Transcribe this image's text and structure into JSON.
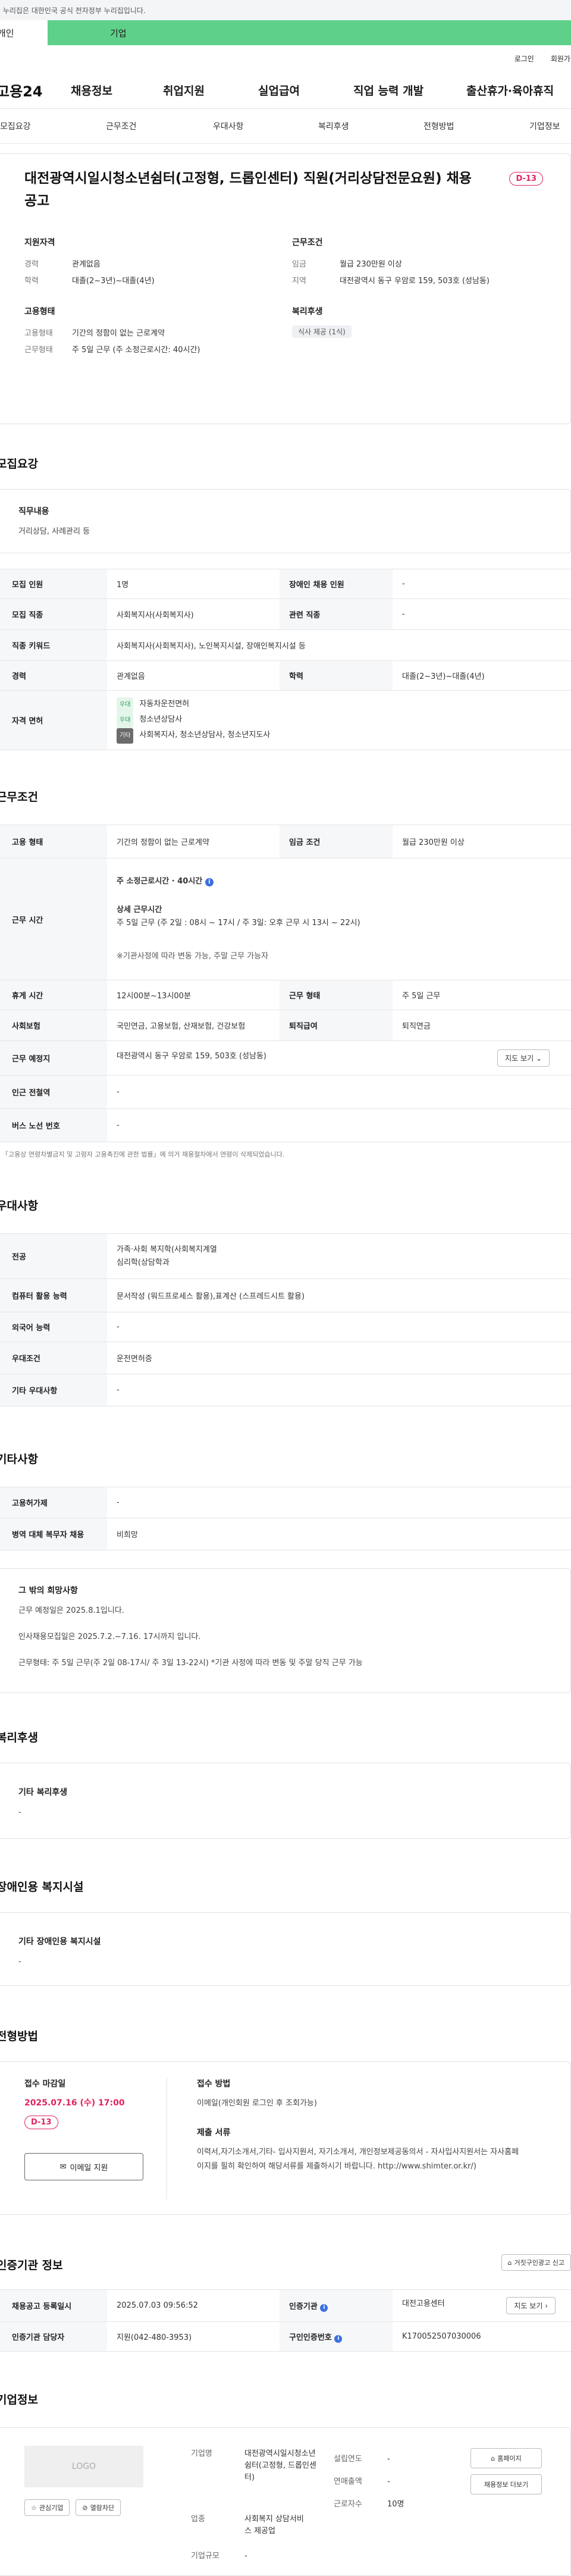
{
  "gov_banner": "이 누리집은 대한민국 공식 전자정부 누리집입니다.",
  "user_tabs": {
    "personal": "개인",
    "company": "기업"
  },
  "util": {
    "login": "로그인",
    "join": "회원가입"
  },
  "gnb": {
    "logo": "고용24",
    "menu": [
      "채용정보",
      "취업지원",
      "실업급여",
      "직업 능력 개발",
      "출산휴가·육아휴직"
    ]
  },
  "sub_tabs": [
    "모집요강",
    "근무조건",
    "우대사항",
    "복리후생",
    "전형방법",
    "기업정보"
  ],
  "summary": {
    "title": "대전광역시일시청소년쉼터(고정형, 드롭인센터) 직원(거리상담전문요원) 채용 공고",
    "dday": "D-13",
    "qual": {
      "heading": "지원자격",
      "career_k": "경력",
      "career_v": "관계없음",
      "edu_k": "학력",
      "edu_v": "대졸(2~3년)~대졸(4년)"
    },
    "cond": {
      "heading": "근무조건",
      "wage_k": "임금",
      "wage_v": "월급 230만원 이상",
      "loc_k": "지역",
      "loc_v": "대전광역시 동구 우암로 159, 503호 (성남동)"
    },
    "emp": {
      "heading": "고용형태",
      "type_k": "고용형태",
      "type_v": "기간의 정함이 없는 근로계약",
      "hours_k": "근무형태",
      "hours_v": "주 5일 근무 (주 소정근로시간: 40시간)"
    },
    "welfare": {
      "heading": "복리후생",
      "chip": "식사 제공 (1식)"
    }
  },
  "recruit": {
    "title": "모집요강",
    "duty_heading": "직무내용",
    "duty_text": "거리상담, 사례관리 등",
    "rows": {
      "count_k": "모집 인원",
      "count_v": "1명",
      "disabled_k": "장애인 채용 인원",
      "disabled_v": "-",
      "job_k": "모집 직종",
      "job_v": "사회복지사(사회복지사)",
      "industry_k": "관련 직종",
      "industry_v": "-",
      "keyword_k": "직종 키워드",
      "keyword_v": "사회복지사(사회복지사), 노인복지시설, 장애인복지시설 등",
      "career_k": "경력",
      "career_v": "관계없음",
      "edu_k": "학력",
      "edu_v": "대졸(2~3년)~대졸(4년)",
      "license_k": "자격 면허",
      "licenses": [
        {
          "tag": "우대",
          "name": "자동차운전면허"
        },
        {
          "tag": "우대",
          "name": "청소년상담사"
        },
        {
          "tag": "기타",
          "name": "사회복지사, 청소년상담사, 청소년지도사"
        }
      ]
    }
  },
  "work": {
    "title": "근무조건",
    "type_k": "고용 형태",
    "type_v": "기간의 정함이 없는 근로계약",
    "wage_k": "임금 조건",
    "wage_v": "월급 230만원 이상",
    "time_k": "근무 시간",
    "time_line1": "주 소정근로시간 · 40시간",
    "time_detail_h": "상세 근무시간",
    "time_detail": "주 5일 근무 (주 2일 : 08시 ~ 17시 / 주 3일: 오후 근무 시 13시 ~ 22시)",
    "time_note": "※기관사정에 따라 변동 가능, 주말 근무 가능자",
    "break_k": "휴게 시간",
    "break_v": "12시00분~13시00분",
    "form_k": "근무 형태",
    "form_v": "주 5일 근무",
    "ins_k": "사회보험",
    "ins_v": "국민연금, 고용보험, 산재보험, 건강보험",
    "retire_k": "퇴직급여",
    "retire_v": "퇴직연금",
    "place_k": "근무 예정지",
    "place_v": "대전광역시 동구 우암로 159, 503호 (성남동)",
    "map_btn": "지도 보기",
    "subway_k": "인근 전철역",
    "subway_v": "-",
    "bus_k": "버스 노선 번호",
    "bus_v": "-",
    "footnote": "* 「고용상 연령차별금지 및 고령자 고용촉진에 관한 법률」에 의거 채용절차에서 연령이 삭제되었습니다."
  },
  "pref": {
    "title": "우대사항",
    "major_k": "전공",
    "major_v1": "가족·사회 복지학(사회복지계열",
    "major_v2": "심리학(상담학과",
    "pc_k": "컴퓨터 활용 능력",
    "pc_v": "문서작성 (워드프로세스 활용),표계산 (스프레드시트 활용)",
    "lang_k": "외국어 능력",
    "lang_v": "-",
    "cond_k": "우대조건",
    "cond_v": "운전면허증",
    "etc_k": "기타 우대사항",
    "etc_v": "-"
  },
  "other": {
    "title": "기타사항",
    "dorm_k": "고용허가제",
    "dorm_v": "-",
    "mil_k": "병역 대체 복무자 채용",
    "mil_v": "비희망",
    "wish_h": "그 밖의 희망사항",
    "wish1": "근무 예정일은 2025.8.1입니다.",
    "wish2": "인사채용모집일은 2025.7.2.~7.16.  17시까지 입니다.",
    "wish3": "근무형태: 주 5일 근무(주 2일 08-17시/ 주 3일 13-22시) *기관 사정에 따라 변동 및 주말 당직 근무 가능"
  },
  "welfare": {
    "title": "복리후생",
    "h": "기타 복리후생",
    "v": "-"
  },
  "facility": {
    "title": "장애인용 복지시설",
    "h": "기타 장애인용 복지시설",
    "v": "-"
  },
  "method": {
    "title": "전형방법",
    "deadline_h": "접수 마감일",
    "deadline_v": "2025.07.16 (수) 17:00",
    "dday": "D-13",
    "apply_btn": "이메일 지원",
    "way_h": "접수 방법",
    "way_v": "이메일(개인회원 로그인 후 조회가능)",
    "docs_h": "제출 서류",
    "docs_v": "이력서,자기소개서,기타- 입사지원서, 자기소개서, 개인정보제공동의서 - 자사입사지원서는 자사홈페이지를 필히 확인하여 해당서류를 제출하시기 바랍니다.    http://www.shimter.or.kr/)"
  },
  "agency": {
    "title": "인증기관 정보",
    "report_btn": "거짓구인광고 신고",
    "date_k": "채용공고 등록일시",
    "date_v": "2025.07.03 09:56:52",
    "org_k": "인증기관",
    "org_v": "대전고용센터",
    "map_btn": "지도 보기",
    "mgr_k": "인증기관 담당자",
    "mgr_v": "지원(042-480-3953)",
    "no_k": "구인인증번호",
    "no_v": "K170052507030006"
  },
  "company": {
    "title": "기업정보",
    "logo": "LOGO",
    "fav_btn": "관심기업",
    "block_btn": "열람차단",
    "name_k": "기업명",
    "name_v": "대전광역시일시청소년쉼터(고정형, 드롭인센터)",
    "biz_k": "업종",
    "biz_v": "사회복지 상담서비스 제공업",
    "size_k": "기업규모",
    "size_v": "-",
    "founded_k": "설립연도",
    "founded_v": "-",
    "sales_k": "연매출액",
    "sales_v": "-",
    "emp_k": "근로자수",
    "emp_v": "10명",
    "home_btn": "홈페이지",
    "more_btn": "채용정보 더보기"
  }
}
